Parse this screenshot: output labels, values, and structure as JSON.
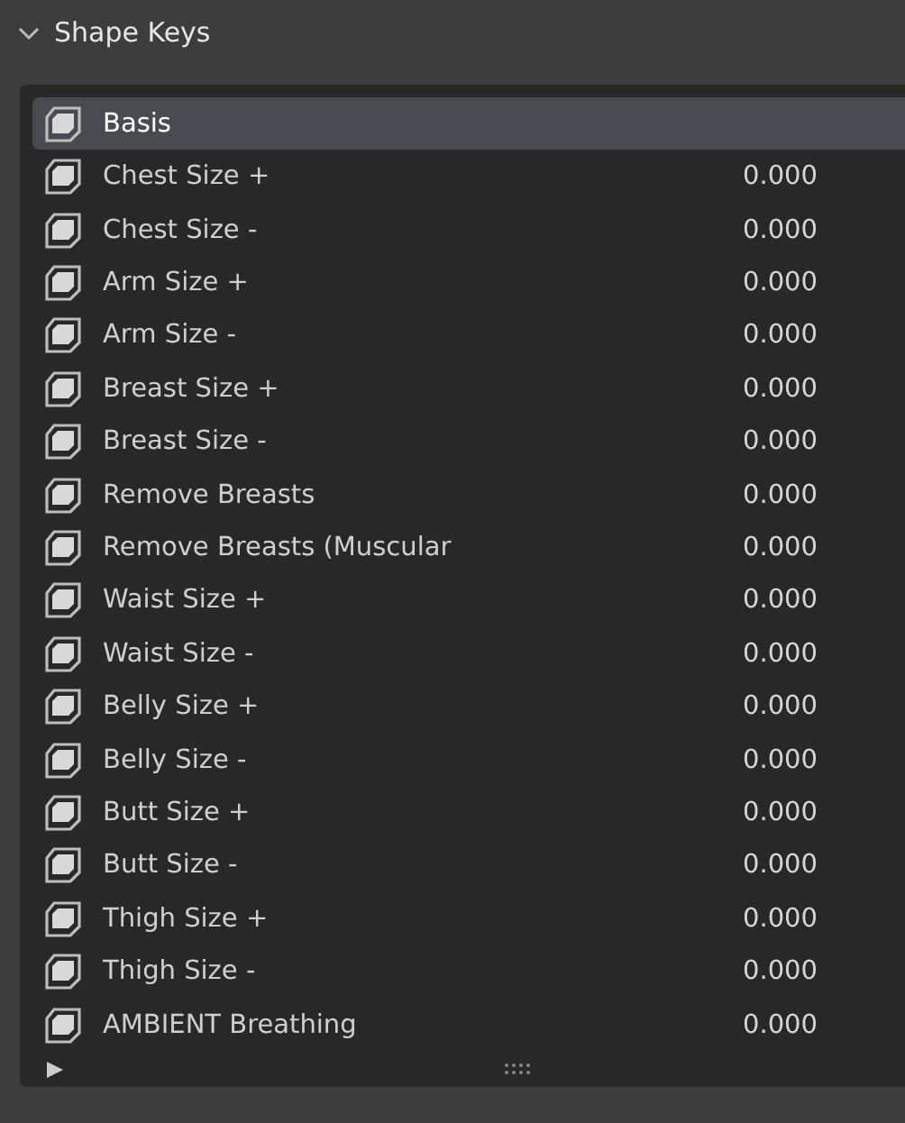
{
  "panel": {
    "title": "Shape Keys",
    "expanded": true
  },
  "shape_keys": [
    {
      "name": "Basis",
      "selected": true
    },
    {
      "name": "Chest Size +",
      "value": "0.000",
      "selected": false
    },
    {
      "name": "Chest Size -",
      "value": "0.000",
      "selected": false
    },
    {
      "name": "Arm Size +",
      "value": "0.000",
      "selected": false
    },
    {
      "name": "Arm Size -",
      "value": "0.000",
      "selected": false
    },
    {
      "name": "Breast Size +",
      "value": "0.000",
      "selected": false
    },
    {
      "name": "Breast Size -",
      "value": "0.000",
      "selected": false
    },
    {
      "name": "Remove Breasts",
      "value": "0.000",
      "selected": false
    },
    {
      "name": "Remove Breasts (Muscular",
      "value": "0.000",
      "selected": false
    },
    {
      "name": "Waist Size +",
      "value": "0.000",
      "selected": false
    },
    {
      "name": "Waist Size -",
      "value": "0.000",
      "selected": false
    },
    {
      "name": "Belly Size +",
      "value": "0.000",
      "selected": false
    },
    {
      "name": "Belly Size -",
      "value": "0.000",
      "selected": false
    },
    {
      "name": "Butt Size +",
      "value": "0.000",
      "selected": false
    },
    {
      "name": "Butt Size -",
      "value": "0.000",
      "selected": false
    },
    {
      "name": "Thigh Size +",
      "value": "0.000",
      "selected": false
    },
    {
      "name": "Thigh Size -",
      "value": "0.000",
      "selected": false
    },
    {
      "name": "AMBIENT Breathing",
      "value": "0.000",
      "selected": false
    }
  ]
}
